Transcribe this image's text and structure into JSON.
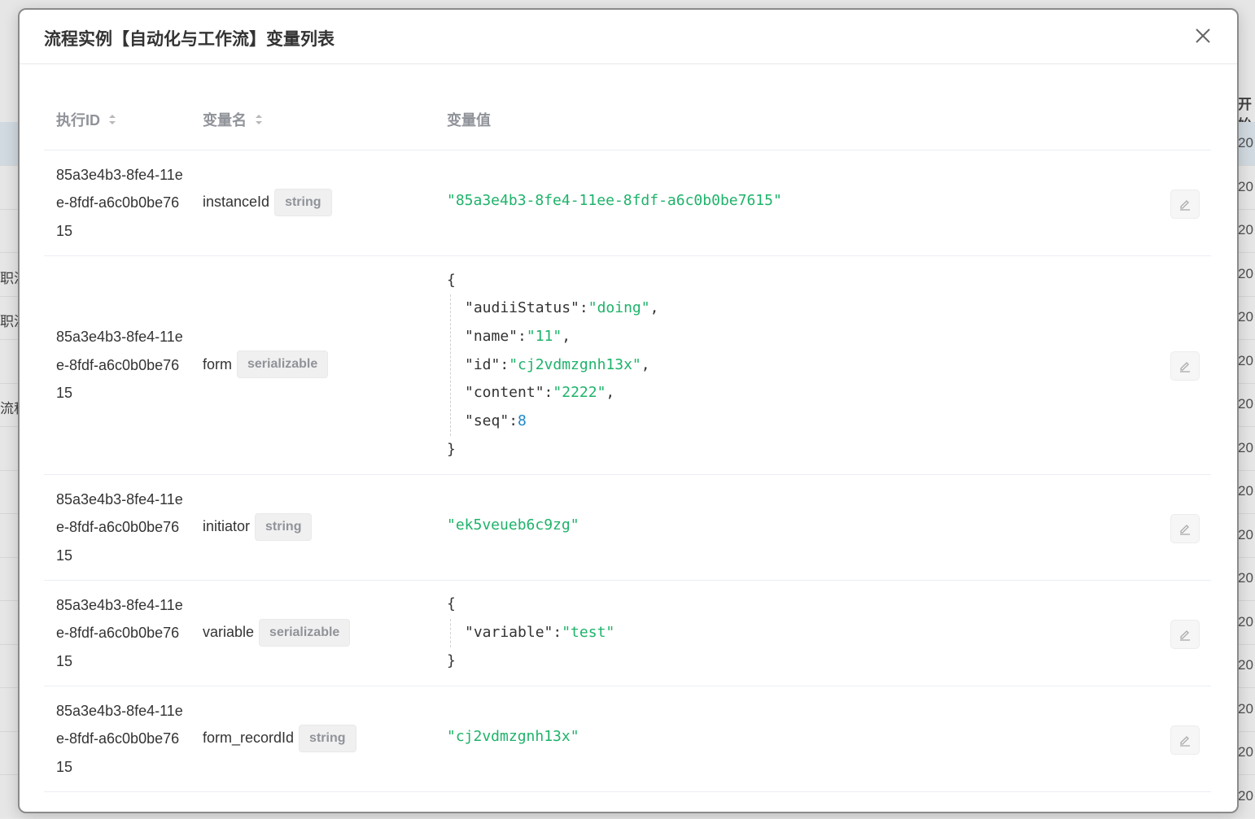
{
  "modal": {
    "title": "流程实例【自动化与工作流】变量列表"
  },
  "table": {
    "headers": {
      "exec_id": "执行ID",
      "var_name": "变量名",
      "var_value": "变量值"
    },
    "rows": [
      {
        "exec_id": "85a3e4b3-8fe4-11ee-8fdf-a6c0b0be7615",
        "name": "instanceId",
        "type": "string",
        "value_str": "\"85a3e4b3-8fe4-11ee-8fdf-a6c0b0be7615\""
      },
      {
        "exec_id": "85a3e4b3-8fe4-11ee-8fdf-a6c0b0be7615",
        "name": "form",
        "type": "serializable",
        "json_open": "{",
        "json_close": "}",
        "json_entries": [
          {
            "key": "\"audiiStatus\"",
            "value": "\"doing\"",
            "kind": "str",
            "comma": ","
          },
          {
            "key": "\"name\"",
            "value": "\"11\"",
            "kind": "str",
            "comma": ","
          },
          {
            "key": "\"id\"",
            "value": "\"cj2vdmzgnh13x\"",
            "kind": "str",
            "comma": ","
          },
          {
            "key": "\"content\"",
            "value": "\"2222\"",
            "kind": "str",
            "comma": ","
          },
          {
            "key": "\"seq\"",
            "value": "8",
            "kind": "num",
            "comma": ""
          }
        ]
      },
      {
        "exec_id": "85a3e4b3-8fe4-11ee-8fdf-a6c0b0be7615",
        "name": "initiator",
        "type": "string",
        "value_str": "\"ek5veueb6c9zg\""
      },
      {
        "exec_id": "85a3e4b3-8fe4-11ee-8fdf-a6c0b0be7615",
        "name": "variable",
        "type": "serializable",
        "json_open": "{",
        "json_close": "}",
        "json_entries": [
          {
            "key": "\"variable\"",
            "value": "\"test\"",
            "kind": "str",
            "comma": ""
          }
        ]
      },
      {
        "exec_id": "85a3e4b3-8fe4-11ee-8fdf-a6c0b0be7615",
        "name": "form_recordId",
        "type": "string",
        "value_str": "\"cj2vdmzgnh13x\""
      }
    ]
  },
  "background": {
    "right_header": "开始",
    "right_cell": "20",
    "left_texts": [
      "职流",
      "职流",
      "流程"
    ]
  },
  "colors": {
    "string_value": "#1eb36a",
    "number_value": "#1e88c8",
    "tag_bg": "#f0f0f0",
    "header_text": "#909399"
  }
}
